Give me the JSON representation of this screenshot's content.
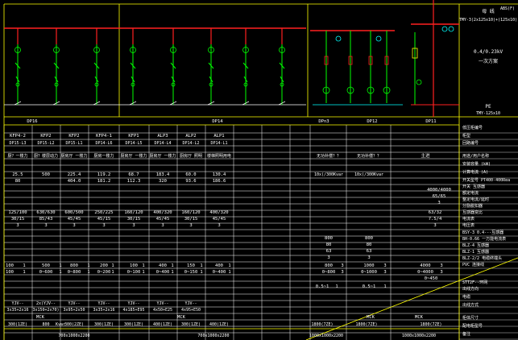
{
  "colors": {
    "bg": "#000000",
    "grid": "#ffffff",
    "yellow": "#ffff00",
    "red": "#ff2020",
    "green": "#00ff00",
    "cyan": "#00ffff",
    "magenta": "#ff00ff"
  },
  "busbar_label": {
    "l1": "母 线",
    "l2": "TMY-3(2x125x10)+(125x10)",
    "l3": "0.4/0.23kV",
    "l4": "一次方案"
  },
  "pe_label": {
    "l1": "PE",
    "l2": "TMY-125x10"
  },
  "panel_names": [
    "DP16",
    "DP14",
    "DPn3",
    "DP12",
    "DP11"
  ],
  "feeders": [
    {
      "code": "KFP4-2",
      "panel": "DP15-L3",
      "use": "厨？一楼力",
      "pe": "25.5",
      "ijs": "80",
      "ie": "125/100",
      "ratio": "30/15",
      "qty": "3"
    },
    {
      "code": "KFP2",
      "panel": "DP15-L2",
      "use": "厨？楼层动力",
      "pe": "500",
      "ijs": "",
      "ie": "630/630",
      "ratio": "85/43",
      "qty": "3"
    },
    {
      "code": "KFP2",
      "panel": "DP15-L1",
      "use": "厨房厅 一楼力",
      "pe": "225.4",
      "ijs": "404.0",
      "ie": "600/500",
      "ratio": "45/45",
      "qty": "3"
    },
    {
      "code": "KFP4-1",
      "panel": "DP14-L6",
      "use": "厨房一楼力",
      "pe": "119.2",
      "ijs": "181.2",
      "ie": "250/225",
      "ratio": "45/15",
      "qty": "3"
    },
    {
      "code": "KFP1",
      "panel": "DP14-L5",
      "use": "厨房厅 一楼力",
      "pe": "68.7",
      "ijs": "112.3",
      "ie": "160/120",
      "ratio": "30/15",
      "qty": "3"
    },
    {
      "code": "ALP3",
      "panel": "DP14-L4",
      "use": "厨房厅 一楼力",
      "pe": "183.4",
      "ijs": "320",
      "ie": "400/320",
      "ratio": "45/45",
      "qty": "3"
    },
    {
      "code": "ALP2",
      "panel": "DP14-L2",
      "use": "厨房厅 照明",
      "pe": "60.0",
      "ijs": "93.6",
      "ie": "160/120",
      "ratio": "30/15",
      "qty": "3"
    },
    {
      "code": "ALP1",
      "panel": "DP14-L1",
      "use": "楼梯照明用电",
      "pe": "130.4",
      "ijs": "186.6",
      "ie": "400/320",
      "ratio": "45/45",
      "qty": "3"
    }
  ],
  "cap_cols": [
    {
      "use": "无功补偿？？",
      "pe": "10x(/300Kvar",
      "v1": "800",
      "v2": "80",
      "v3": "63",
      "v4": "3"
    },
    {
      "use": "无功补偿？？",
      "pe": "10x(/300Kvar",
      "v1": "800",
      "v2": "80",
      "v3": "63",
      "v4": "3"
    }
  ],
  "incoming": {
    "use": "主进",
    "pe": "4000/4000",
    "ijs": "65/65",
    "qty": "3",
    "ratio1": "63/32",
    "ratio2": "7.5/4",
    "qty2": "3"
  },
  "ct_row": {
    "a": [
      "100",
      "1",
      "500",
      "1",
      "800",
      "1",
      "200",
      "1",
      "100",
      "1",
      "400",
      "1",
      "150",
      "1",
      "400",
      "1"
    ],
    "b": [
      "100",
      "1",
      "0~600",
      "1",
      "0~800",
      "1",
      "0~200",
      "1",
      "0~100",
      "1",
      "0~400",
      "1",
      "0~150",
      "1",
      "0~400",
      "1"
    ],
    "cap": [
      "800",
      "3",
      "1000",
      "3"
    ],
    "cap_b": [
      "0~800",
      "3",
      "0~1000",
      "3"
    ],
    "inc": [
      "4000",
      "3"
    ],
    "inc_b": [
      "0~4000",
      "3",
      "0~450"
    ]
  },
  "cap_small": [
    "0.5~1",
    "1",
    "0.5~1",
    "1"
  ],
  "cables": [
    {
      "type": "YJV--",
      "size": "3x35+2x16"
    },
    {
      "type": "2x(YJV--",
      "size": "3x150+2x70)"
    },
    {
      "type": "YJV--",
      "size": "3x95+2x50"
    },
    {
      "type": "YJV--",
      "size": "3x35+2x16"
    },
    {
      "type": "YJV--",
      "size": "4x185+E95"
    },
    {
      "type": "YJV--",
      "size": "4x50+E25"
    },
    {
      "type": "YJV--",
      "size": "4x95+E50"
    }
  ],
  "mck": [
    "MCK",
    "MCK",
    "MCK",
    "MCK"
  ],
  "cab_sizes": [
    "300(1ZE)",
    "800",
    "300(2ZE)",
    "300(1ZE)",
    "300(1ZE)",
    "400(1ZE)",
    "300(1ZE)",
    "400(1ZE)",
    "1800(7ZE)",
    "1800(7ZE)",
    "1800(7ZE)"
  ],
  "dims": [
    "700x1000x2200",
    "700x1000x2200",
    "1000x1000x2200",
    "1000x1000x2200"
  ],
  "cap_units": "Kvar",
  "row_labels": {
    "r1": "低压柜编号",
    "r2": "柜型",
    "r3": "回路编号",
    "r4": "用途/用户名称",
    "r5": "安装容量 (kW)",
    "r6": "计算电流 (A)",
    "r7": "开关型号 PT400-400Rea",
    "r8": "开关 互感器",
    "r9": "额定电流",
    "r10": "整定电流/延时",
    "r11": "分励脱扣器",
    "r12": "互感器变比",
    "r13": "电流表",
    "r14": "电压表",
    "r15": "电缆",
    "r16": "出线方式",
    "r17": "柜体尺寸",
    "r18": "配电柜型号",
    "r19": "备注",
    "t1": "BSY-3 0.4---互感器",
    "t2": "BH-0.66 一万能电流表",
    "t3": "BLZ-4 互感器",
    "t4": "BLZ-1 互感器",
    "t5": "BLZ-2/2 电缆终端头",
    "t6": "PVC 连接线",
    "t7": "STT2F--环网",
    "t8": "出线方向"
  },
  "top_right_code": "ABS(F)"
}
